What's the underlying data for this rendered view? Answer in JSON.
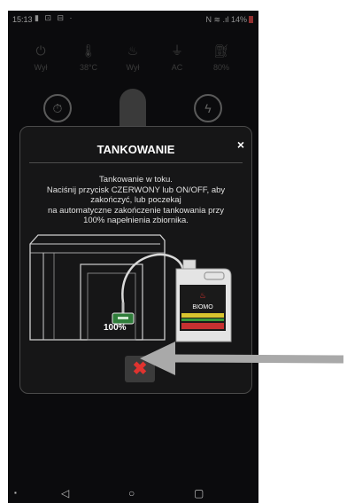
{
  "status_bar": {
    "time": "15:13",
    "left_icons": "▮ ⊡ ⊟ ·",
    "right_text": "N ≋ .ıl 14%"
  },
  "top_icons": [
    {
      "icon": "power-timer-icon",
      "label": "Wył"
    },
    {
      "icon": "thermometer-icon",
      "label": "38°C"
    },
    {
      "icon": "flame-icon",
      "label": "Wył"
    },
    {
      "icon": "plug-icon",
      "label": "AC"
    },
    {
      "icon": "fuel-pump-icon",
      "label": "80%"
    }
  ],
  "dialog": {
    "title": "TANKOWANIE",
    "close_glyph": "×",
    "message_lines": [
      "Tankowanie w toku.",
      "Naciśnij przycisk CZERWONY lub ON/OFF, aby",
      "zakończyć, lub poczekaj",
      "na automatyczne zakończenie tankowania przy",
      "100% napełnienia zbiornika."
    ],
    "fill_percent_label": "100%",
    "canister_brand": "BIOMO",
    "stop_glyph": "✖"
  },
  "colors": {
    "background": "#111214",
    "dialog_bg": "#161617",
    "accent_red": "#e0332f",
    "canister_green": "#2f7d3a",
    "arrow_gray": "#a9a9a9"
  }
}
